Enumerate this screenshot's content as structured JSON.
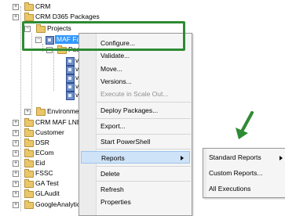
{
  "tree": {
    "top_items": [
      "CRM",
      "CRM D365 Packages"
    ],
    "projects": "Projects",
    "selected_project": "MAF Fa",
    "packages_folder": "Pack",
    "package_prefix": "v",
    "environments": "Environmer",
    "lower_items": [
      "CRM MAF LNE",
      "Customer",
      "DSR",
      "ECom",
      "Eid",
      "FSSC",
      "GA Test",
      "GLAudit",
      "GoogleAnalytic"
    ]
  },
  "context_menu": {
    "items": [
      {
        "label": "Configure...",
        "enabled": true
      },
      {
        "label": "Validate...",
        "enabled": true
      },
      {
        "label": "Move...",
        "enabled": true
      },
      {
        "label": "Versions...",
        "enabled": true
      },
      {
        "label": "Execute in Scale Out...",
        "enabled": false
      },
      {
        "label": "Deploy Packages...",
        "enabled": true
      },
      {
        "label": "Export...",
        "enabled": true
      },
      {
        "label": "Start PowerShell",
        "enabled": true
      },
      {
        "label": "Reports",
        "enabled": true,
        "highlighted": true,
        "has_submenu": true
      },
      {
        "label": "Delete",
        "enabled": true
      },
      {
        "label": "Refresh",
        "enabled": true
      },
      {
        "label": "Properties",
        "enabled": true
      }
    ]
  },
  "reports_submenu": {
    "items": [
      "Standard Reports",
      "Custom Reports...",
      "All Executions"
    ]
  },
  "colors": {
    "selection": "#3399ff",
    "menu_highlight": "#cfe3f8",
    "annotation_green": "#2e8b34",
    "folder": "#e9c769"
  }
}
